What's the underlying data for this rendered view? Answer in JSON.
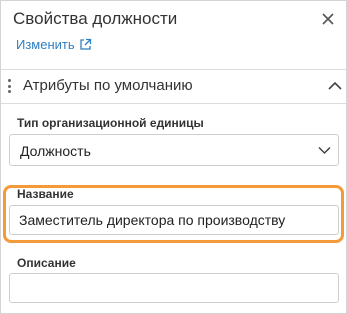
{
  "panel": {
    "title": "Свойства должности",
    "edit_link": "Изменить"
  },
  "section": {
    "title": "Атрибуты по умолчанию",
    "expanded": true
  },
  "fields": {
    "org_unit_type": {
      "label": "Тип организационной единицы",
      "value": "Должность"
    },
    "name": {
      "label": "Название",
      "value": "Заместитель директора по производству"
    },
    "description": {
      "label": "Описание",
      "value": ""
    }
  },
  "colors": {
    "accent_link": "#2f7fc1",
    "highlight": "#f39a3b"
  },
  "icons": [
    "close-icon",
    "external-link-icon",
    "drag-handle-icon",
    "chevron-up-icon",
    "chevron-down-icon"
  ]
}
